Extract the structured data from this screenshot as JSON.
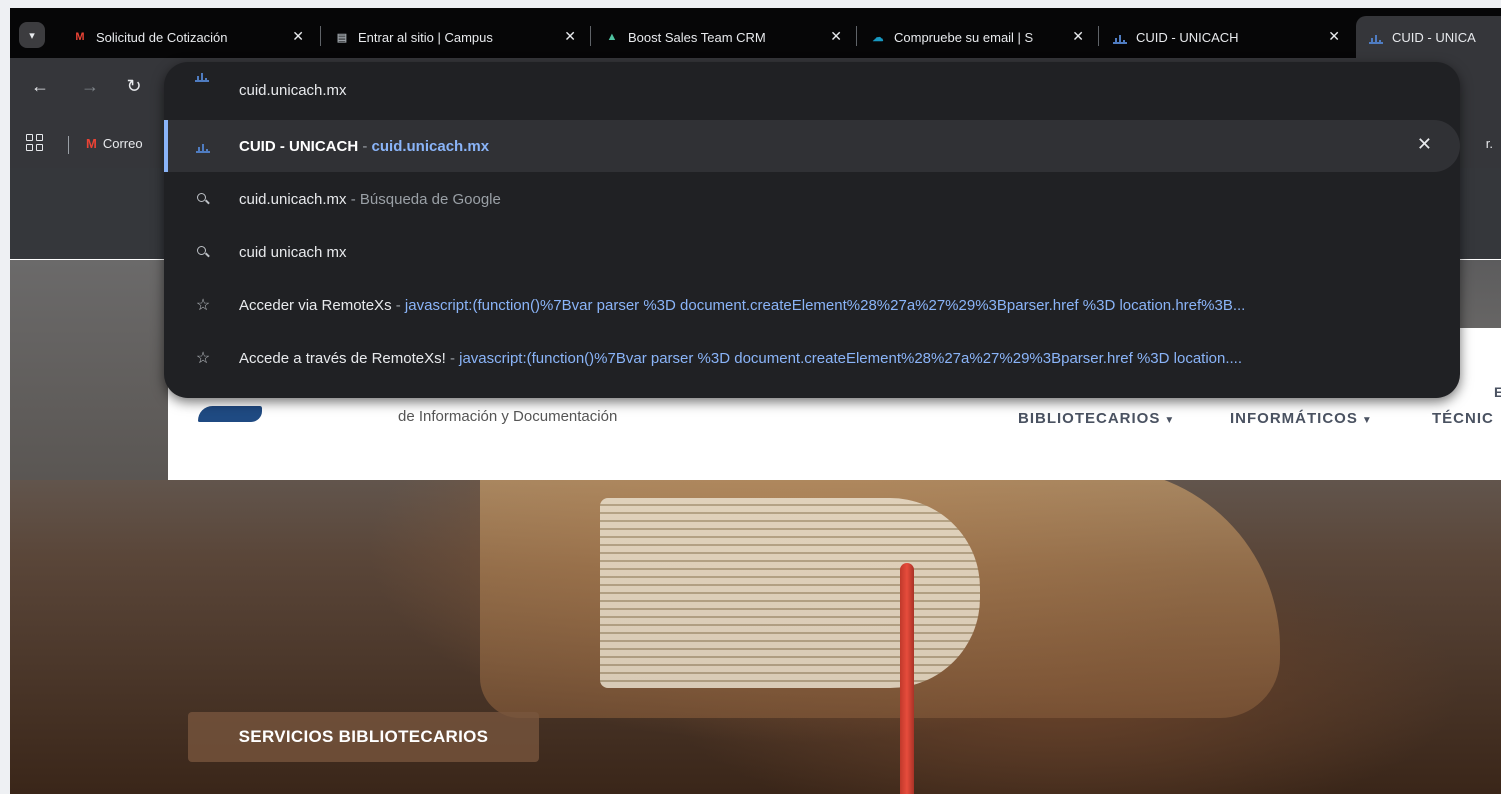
{
  "tabs": [
    {
      "title": "Solicitud de Cotización",
      "icon": "gmail-icon"
    },
    {
      "title": "Entrar al sitio | Campus",
      "icon": "campus-icon"
    },
    {
      "title": "Boost Sales Team CRM",
      "icon": "crm-icon"
    },
    {
      "title": "Compruebe su email | S",
      "icon": "salesforce-cloud-icon"
    },
    {
      "title": "CUID - UNICACH",
      "icon": "cuid-chart-icon"
    },
    {
      "title": "CUID - UNICA",
      "icon": "cuid-chart-icon"
    }
  ],
  "bookmarks": {
    "first_label": "Correo",
    "tail_label": "r."
  },
  "omnibox": {
    "input_text": "cuid.unicach.mx",
    "suggestions": [
      {
        "title": "CUID - UNICACH",
        "sep": " - ",
        "url": "cuid.unicach.mx",
        "icon": "cuid-chart-icon"
      },
      {
        "title": "cuid.unicach.mx",
        "sep": " - ",
        "desc": "Búsqueda de Google",
        "icon": "search-icon"
      },
      {
        "title": "cuid unicach mx",
        "icon": "search-icon"
      },
      {
        "title": "Acceder via RemoteXs",
        "sep": " - ",
        "url": "javascript:(function()%7Bvar parser %3D document.createElement%28%27a%27%29%3Bparser.href %3D location.href%3B...",
        "icon": "star-icon"
      },
      {
        "title": "Accede a través de RemoteXs!",
        "sep": " - ",
        "url": "javascript:(function()%7Bvar parser %3D document.createElement%28%27a%27%29%3Bparser.href %3D location....",
        "icon": "star-icon"
      }
    ]
  },
  "site": {
    "subtitle": "de Información y Documentación",
    "menu": [
      "BIBLIOTECARIOS",
      "INFORMÁTICOS",
      "TÉCNIC"
    ],
    "menu_chevron": "⌄",
    "edge_letter": "E",
    "cta": "SERVICIOS BIBLIOTECARIOS"
  },
  "colors": {
    "accent": "#8ab4f8",
    "ribbon": "#c0392b",
    "cta_bg": "#78563e"
  }
}
